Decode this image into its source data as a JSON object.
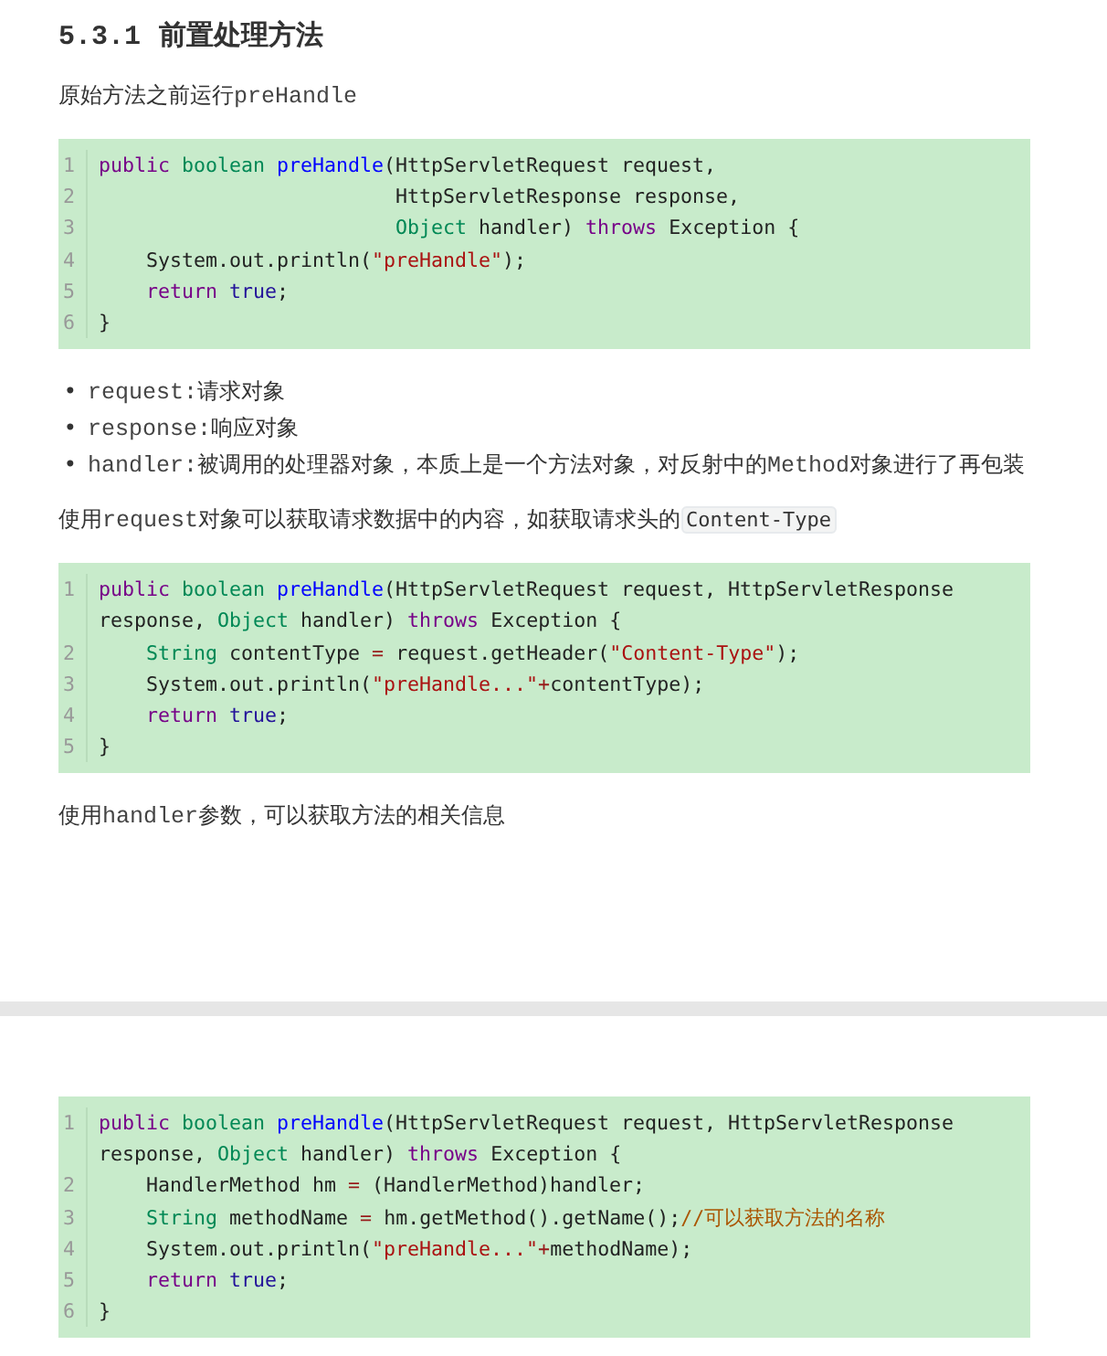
{
  "pages": [
    {
      "blocks": [
        {
          "kind": "heading",
          "number": "5.3.1",
          "title": "前置处理方法"
        },
        {
          "kind": "paragraph",
          "parts": [
            {
              "kind": "text",
              "text": "原始方法之前运行"
            },
            {
              "kind": "mono",
              "text": "preHandle"
            }
          ]
        },
        {
          "kind": "code",
          "lines": [
            {
              "number": "1",
              "kind": "top",
              "tokens": [
                {
                  "kind": "kw",
                  "text": "public"
                },
                {
                  "kind": "type",
                  "text": " boolean"
                },
                {
                  "kind": "def",
                  "text": " preHandle"
                },
                {
                  "kind": "plain",
                  "text": "(HttpServletRequest request,"
                }
              ]
            },
            {
              "number": "2",
              "kind": "args",
              "tokens": [
                {
                  "kind": "plain",
                  "text": "HttpServletResponse response,"
                }
              ]
            },
            {
              "number": "3",
              "kind": "args",
              "tokens": [
                {
                  "kind": "type",
                  "text": "Object"
                },
                {
                  "kind": "plain",
                  "text": " handler) "
                },
                {
                  "kind": "kw",
                  "text": "throws"
                },
                {
                  "kind": "plain",
                  "text": " Exception {"
                }
              ]
            },
            {
              "number": "4",
              "kind": "body",
              "tokens": [
                {
                  "kind": "plain",
                  "text": "System.out.println("
                },
                {
                  "kind": "str",
                  "text": "\"preHandle\""
                },
                {
                  "kind": "plain",
                  "text": ");"
                }
              ]
            },
            {
              "number": "5",
              "kind": "body",
              "tokens": [
                {
                  "kind": "kw",
                  "text": "return"
                },
                {
                  "kind": "atom",
                  "text": " true"
                },
                {
                  "kind": "plain",
                  "text": ";"
                }
              ]
            },
            {
              "number": "6",
              "kind": "top",
              "tokens": [
                {
                  "kind": "plain",
                  "text": "}"
                }
              ]
            }
          ]
        },
        {
          "kind": "list",
          "items": [
            {
              "marker": "•",
              "parts": [
                {
                  "kind": "mono",
                  "text": "request:"
                },
                {
                  "kind": "text",
                  "text": "请求对象"
                }
              ]
            },
            {
              "marker": "•",
              "parts": [
                {
                  "kind": "mono",
                  "text": "response:"
                },
                {
                  "kind": "text",
                  "text": "响应对象"
                }
              ]
            },
            {
              "marker": "•",
              "parts": [
                {
                  "kind": "mono",
                  "text": "handler:"
                },
                {
                  "kind": "text",
                  "text": "被调用的处理器对象，本质上是一个方法对象，对反射中的"
                },
                {
                  "kind": "mono",
                  "text": "Method"
                },
                {
                  "kind": "text",
                  "text": "对象进行了再包装"
                }
              ]
            }
          ]
        },
        {
          "kind": "paragraph",
          "parts": [
            {
              "kind": "text",
              "text": "使用"
            },
            {
              "kind": "mono",
              "text": "request"
            },
            {
              "kind": "text",
              "text": "对象可以获取请求数据中的内容，如获取请求头的"
            },
            {
              "kind": "inline_code",
              "text": "Content-Type"
            }
          ]
        },
        {
          "kind": "code",
          "lines": [
            {
              "number": "1",
              "kind": "top",
              "tokens": [
                {
                  "kind": "kw",
                  "text": "public"
                },
                {
                  "kind": "type",
                  "text": " boolean"
                },
                {
                  "kind": "def",
                  "text": " preHandle"
                },
                {
                  "kind": "plain",
                  "text": "(HttpServletRequest request, HttpServletResponse response, "
                },
                {
                  "kind": "type",
                  "text": "Object"
                },
                {
                  "kind": "plain",
                  "text": " handler) "
                },
                {
                  "kind": "kw",
                  "text": "throws"
                },
                {
                  "kind": "plain",
                  "text": " Exception {"
                }
              ]
            },
            {
              "number": "2",
              "kind": "body",
              "tokens": [
                {
                  "kind": "type",
                  "text": "String"
                },
                {
                  "kind": "plain",
                  "text": " contentType "
                },
                {
                  "kind": "op",
                  "text": "="
                },
                {
                  "kind": "plain",
                  "text": " request.getHeader("
                },
                {
                  "kind": "str",
                  "text": "\"Content-Type\""
                },
                {
                  "kind": "plain",
                  "text": ");"
                }
              ]
            },
            {
              "number": "3",
              "kind": "body",
              "tokens": [
                {
                  "kind": "plain",
                  "text": "System.out.println("
                },
                {
                  "kind": "str",
                  "text": "\"preHandle...\""
                },
                {
                  "kind": "op",
                  "text": "+"
                },
                {
                  "kind": "plain",
                  "text": "contentType);"
                }
              ]
            },
            {
              "number": "4",
              "kind": "body",
              "tokens": [
                {
                  "kind": "kw",
                  "text": "return"
                },
                {
                  "kind": "atom",
                  "text": " true"
                },
                {
                  "kind": "plain",
                  "text": ";"
                }
              ]
            },
            {
              "number": "5",
              "kind": "top",
              "tokens": [
                {
                  "kind": "plain",
                  "text": "}"
                }
              ]
            }
          ]
        },
        {
          "kind": "paragraph",
          "parts": [
            {
              "kind": "text",
              "text": "使用"
            },
            {
              "kind": "mono",
              "text": "handler"
            },
            {
              "kind": "text",
              "text": "参数，可以获取方法的相关信息"
            }
          ]
        }
      ]
    },
    {
      "blocks": [
        {
          "kind": "code",
          "lines": [
            {
              "number": "1",
              "kind": "top",
              "tokens": [
                {
                  "kind": "kw",
                  "text": "public"
                },
                {
                  "kind": "type",
                  "text": " boolean"
                },
                {
                  "kind": "def",
                  "text": " preHandle"
                },
                {
                  "kind": "plain",
                  "text": "(HttpServletRequest request, HttpServletResponse response, "
                },
                {
                  "kind": "type",
                  "text": "Object"
                },
                {
                  "kind": "plain",
                  "text": " handler) "
                },
                {
                  "kind": "kw",
                  "text": "throws"
                },
                {
                  "kind": "plain",
                  "text": " Exception {"
                }
              ]
            },
            {
              "number": "2",
              "kind": "body",
              "tokens": [
                {
                  "kind": "plain",
                  "text": "HandlerMethod hm "
                },
                {
                  "kind": "op",
                  "text": "="
                },
                {
                  "kind": "plain",
                  "text": " (HandlerMethod)handler;"
                }
              ]
            },
            {
              "number": "3",
              "kind": "body",
              "tokens": [
                {
                  "kind": "type",
                  "text": "String"
                },
                {
                  "kind": "plain",
                  "text": " methodName "
                },
                {
                  "kind": "op",
                  "text": "="
                },
                {
                  "kind": "plain",
                  "text": " hm.getMethod().getName();"
                },
                {
                  "kind": "comment",
                  "text": "//可以获取方法的名称"
                }
              ]
            },
            {
              "number": "4",
              "kind": "body",
              "tokens": [
                {
                  "kind": "plain",
                  "text": "System.out.println("
                },
                {
                  "kind": "str",
                  "text": "\"preHandle...\""
                },
                {
                  "kind": "op",
                  "text": "+"
                },
                {
                  "kind": "plain",
                  "text": "methodName);"
                }
              ]
            },
            {
              "number": "5",
              "kind": "body",
              "tokens": [
                {
                  "kind": "kw",
                  "text": "return"
                },
                {
                  "kind": "atom",
                  "text": " true"
                },
                {
                  "kind": "plain",
                  "text": ";"
                }
              ]
            },
            {
              "number": "6",
              "kind": "top",
              "tokens": [
                {
                  "kind": "plain",
                  "text": "}"
                }
              ]
            }
          ]
        }
      ]
    }
  ]
}
